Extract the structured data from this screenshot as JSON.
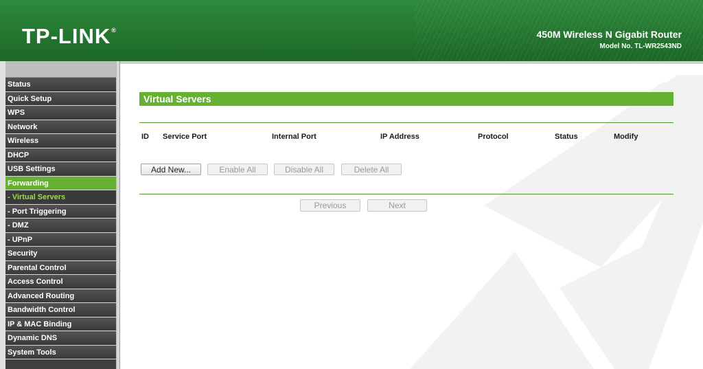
{
  "header": {
    "logo": "TP-LINK",
    "logo_reg": "®",
    "product_name": "450M Wireless N Gigabit Router",
    "model": "Model No. TL-WR2543ND"
  },
  "menu": [
    {
      "label": "Status",
      "type": "main"
    },
    {
      "label": "Quick Setup",
      "type": "main"
    },
    {
      "label": "WPS",
      "type": "main"
    },
    {
      "label": "Network",
      "type": "main"
    },
    {
      "label": "Wireless",
      "type": "main"
    },
    {
      "label": "DHCP",
      "type": "main"
    },
    {
      "label": "USB Settings",
      "type": "main"
    },
    {
      "label": "Forwarding",
      "type": "main-active"
    },
    {
      "label": "- Virtual Servers",
      "type": "sub-active"
    },
    {
      "label": "- Port Triggering",
      "type": "sub"
    },
    {
      "label": "- DMZ",
      "type": "sub"
    },
    {
      "label": "- UPnP",
      "type": "sub"
    },
    {
      "label": "Security",
      "type": "main"
    },
    {
      "label": "Parental Control",
      "type": "main"
    },
    {
      "label": "Access Control",
      "type": "main"
    },
    {
      "label": "Advanced Routing",
      "type": "main"
    },
    {
      "label": "Bandwidth Control",
      "type": "main"
    },
    {
      "label": "IP & MAC Binding",
      "type": "main"
    },
    {
      "label": "Dynamic DNS",
      "type": "main"
    },
    {
      "label": "System Tools",
      "type": "main"
    }
  ],
  "page": {
    "title": "Virtual Servers",
    "columns": [
      "ID",
      "Service Port",
      "Internal Port",
      "IP Address",
      "Protocol",
      "Status",
      "Modify"
    ],
    "buttons": {
      "add_new": "Add New...",
      "enable_all": "Enable All",
      "disable_all": "Disable All",
      "delete_all": "Delete All",
      "previous": "Previous",
      "next": "Next"
    }
  },
  "colors": {
    "header_green": "#24762f",
    "accent_green": "#66b032",
    "menu_dark": "#3f3f3f"
  }
}
